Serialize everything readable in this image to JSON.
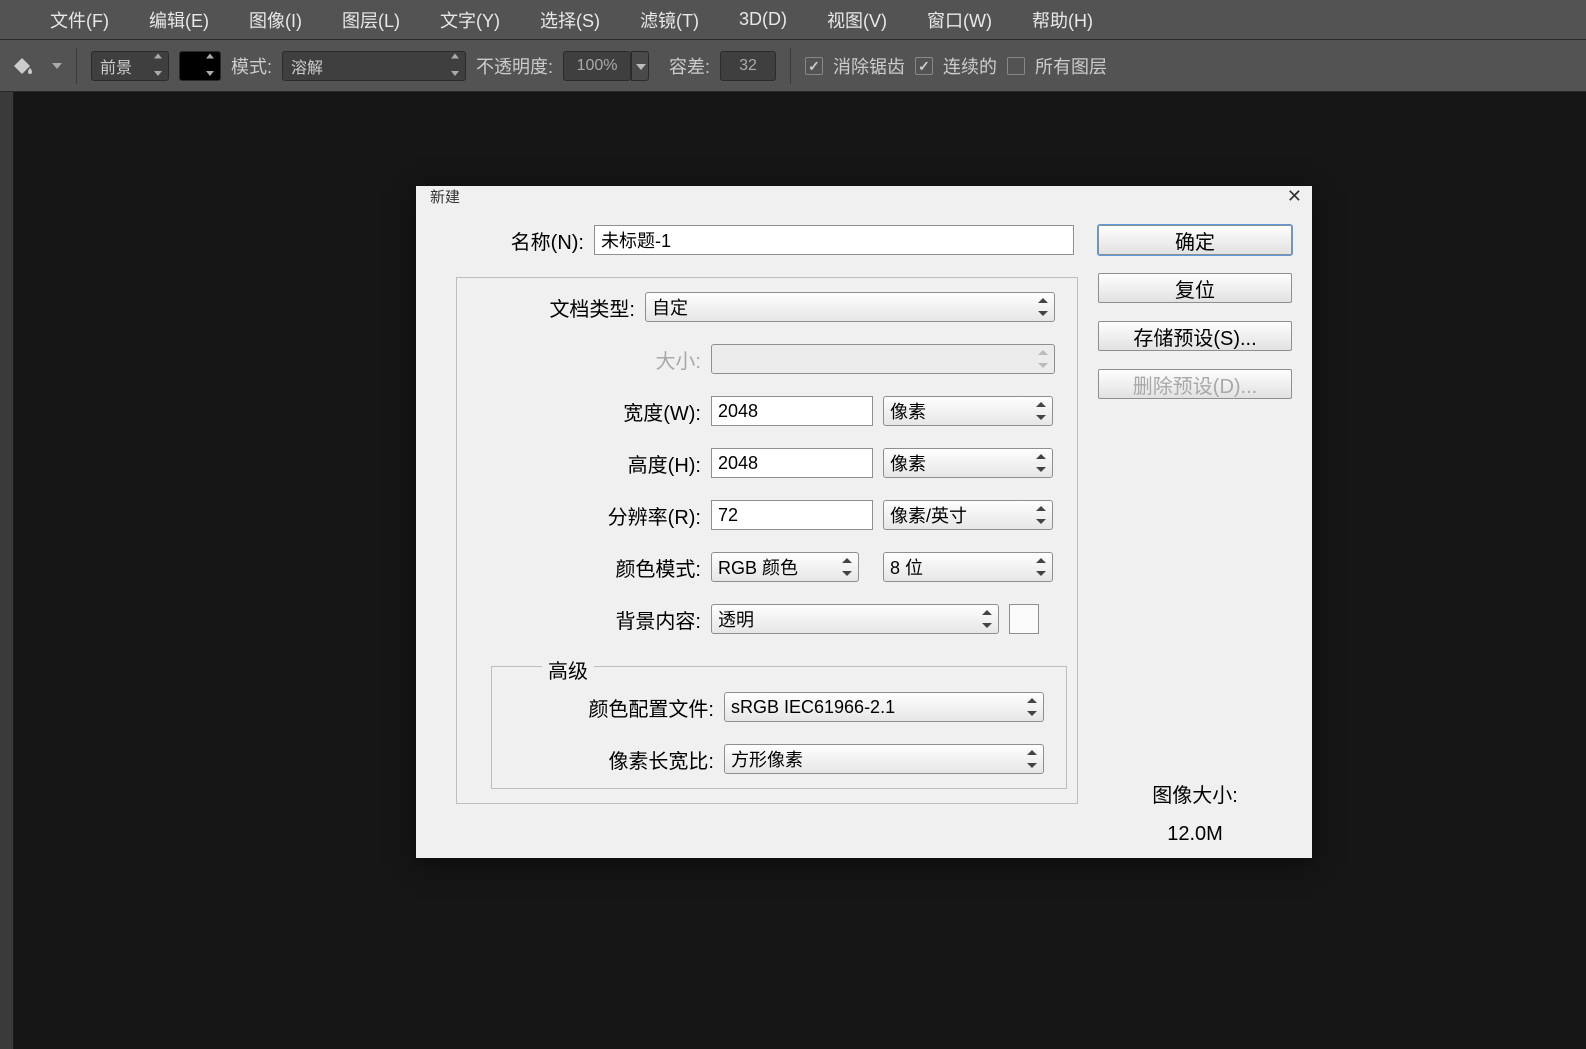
{
  "menu": [
    "文件(F)",
    "编辑(E)",
    "图像(I)",
    "图层(L)",
    "文字(Y)",
    "选择(S)",
    "滤镜(T)",
    "3D(D)",
    "视图(V)",
    "窗口(W)",
    "帮助(H)"
  ],
  "opt": {
    "fill_target": "前景",
    "mode_label": "模式:",
    "mode_value": "溶解",
    "opacity_label": "不透明度:",
    "opacity_value": "100%",
    "tolerance_label": "容差:",
    "tolerance_value": "32",
    "anti_alias": "消除锯齿",
    "contiguous": "连续的",
    "all_layers": "所有图层"
  },
  "dlg": {
    "title": "新建",
    "name_label": "名称(N):",
    "name_value": "未标题-1",
    "doc_type_label": "文档类型:",
    "doc_type_value": "自定",
    "size_label": "大小:",
    "width_label": "宽度(W):",
    "width_value": "2048",
    "width_unit": "像素",
    "height_label": "高度(H):",
    "height_value": "2048",
    "height_unit": "像素",
    "res_label": "分辨率(R):",
    "res_value": "72",
    "res_unit": "像素/英寸",
    "mode_label": "颜色模式:",
    "mode_value": "RGB 颜色",
    "bit_depth": "8 位",
    "bg_label": "背景内容:",
    "bg_value": "透明",
    "adv_legend": "高级",
    "profile_label": "颜色配置文件:",
    "profile_value": "sRGB IEC61966-2.1",
    "aspect_label": "像素长宽比:",
    "aspect_value": "方形像素",
    "ok": "确定",
    "reset": "复位",
    "save_preset": "存储预设(S)...",
    "delete_preset": "删除预设(D)...",
    "img_size_label": "图像大小:",
    "img_size_value": "12.0M"
  }
}
